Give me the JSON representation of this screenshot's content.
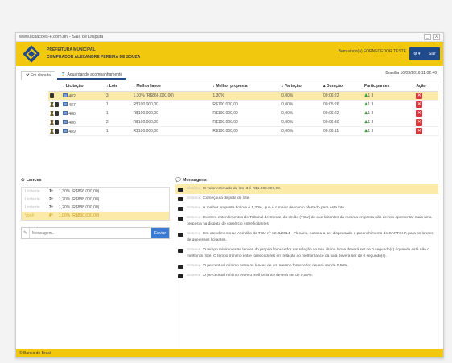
{
  "titlebar": {
    "title": "www.licitacoes-e.com.br/ - Sala de Disputa",
    "controls": [
      "_",
      "X"
    ]
  },
  "header": {
    "org1": "PREFEITURA MUNICIPAL",
    "org2": "COMPRADOR ALEXANDRE PEREIRA DE SOUZA",
    "user": "Bem-vindo(a) FORNECEDOR TESTE",
    "user_btn": "Sair"
  },
  "tabs": [
    {
      "label": "Em disputa"
    },
    {
      "label": "Aguardando acompanhamento"
    }
  ],
  "clock": "Brasília 16/03/2016 11:02:40",
  "table": {
    "headers": [
      "Licitação",
      "Lote",
      "Melhor lance",
      "Melhor proposta",
      "Variação",
      "Duração",
      "Participantes",
      "Ação"
    ],
    "rows": [
      {
        "lic": "482",
        "lote": "3",
        "lance": "1,30%  (R$866.000,00)",
        "prop": "1,30%",
        "var": "0,00%",
        "dur": "00:06:22",
        "parts": "1  3"
      },
      {
        "lic": "487",
        "lote": "1",
        "lance": "R$100.000,00",
        "prop": "R$100.000,00",
        "var": "0,00%",
        "dur": "00:05:26",
        "parts": "1  3"
      },
      {
        "lic": "488",
        "lote": "1",
        "lance": "R$100.000,00",
        "prop": "R$100.000,00",
        "var": "0,00%",
        "dur": "00:06:22",
        "parts": "1  3"
      },
      {
        "lic": "480",
        "lote": "2",
        "lance": "R$100.000,00",
        "prop": "R$100.000,00",
        "var": "0,00%",
        "dur": "00:06:30",
        "parts": "1  3"
      },
      {
        "lic": "489",
        "lote": "1",
        "lance": "R$100.000,00",
        "prop": "R$100.000,00",
        "var": "0,00%",
        "dur": "00:06:11",
        "parts": "1  3"
      }
    ]
  },
  "lances": {
    "title": "Lances",
    "items": [
      {
        "who": "Licitante",
        "pos": "1º",
        "val": "1,30%  (R$866.000,00)"
      },
      {
        "who": "Licitante",
        "pos": "2º",
        "val": "1,20%  (R$888.000,00)"
      },
      {
        "who": "Licitante",
        "pos": "3º",
        "val": "1,20%  (R$888.000,00)"
      },
      {
        "who": "Você",
        "pos": "4º",
        "val": "1,00%  (R$890.000,00)"
      }
    ]
  },
  "chat": {
    "placeholder": "Mensagem...",
    "send": "Enviar"
  },
  "mensagens": {
    "title": "Mensagens",
    "items": [
      {
        "who": "Sistema",
        "text": "O valor estimado do lote 3 é R$1.000.000,00."
      },
      {
        "who": "Sistema",
        "text": "Começou a disputa do lote."
      },
      {
        "who": "Sistema",
        "text": "A melhor proposta do lote é 1,30%, que é o maior desconto ofertado para este lote."
      },
      {
        "who": "Sistema",
        "text": "Existem entendimentos do Tribunal de Contas da União (TCU) de que licitantes da mesma empresa não devem apresentar mais uma proposta na disputa de comércio entre licitantes."
      },
      {
        "who": "Sistema",
        "text": "Em atendimento ao Acórdão do TCU nº 1216/2014 - Plenário, passou a ser dispensado o preenchimento do CAPTCHA para os lances de que esses licitantes."
      },
      {
        "who": "Sistema",
        "text": "O tempo mínimo entre lances do próprio fornecedor em relação ao seu último lance deverá ser de 0 segundo(s) / quando está não o melhor do lote. O tempo mínimo entre fornecedores em relação ao melhor lance da sala deverá ser de 0 segundo(s)."
      },
      {
        "who": "Sistema",
        "text": "O percentual mínimo entre os lances de um mesmo fornecedor deverá ser de 0,50%."
      },
      {
        "who": "Sistema",
        "text": "O percentual mínimo entre o melhor lance deverá ser de 0,50%."
      }
    ]
  },
  "footer": "© Banco do Brasil"
}
